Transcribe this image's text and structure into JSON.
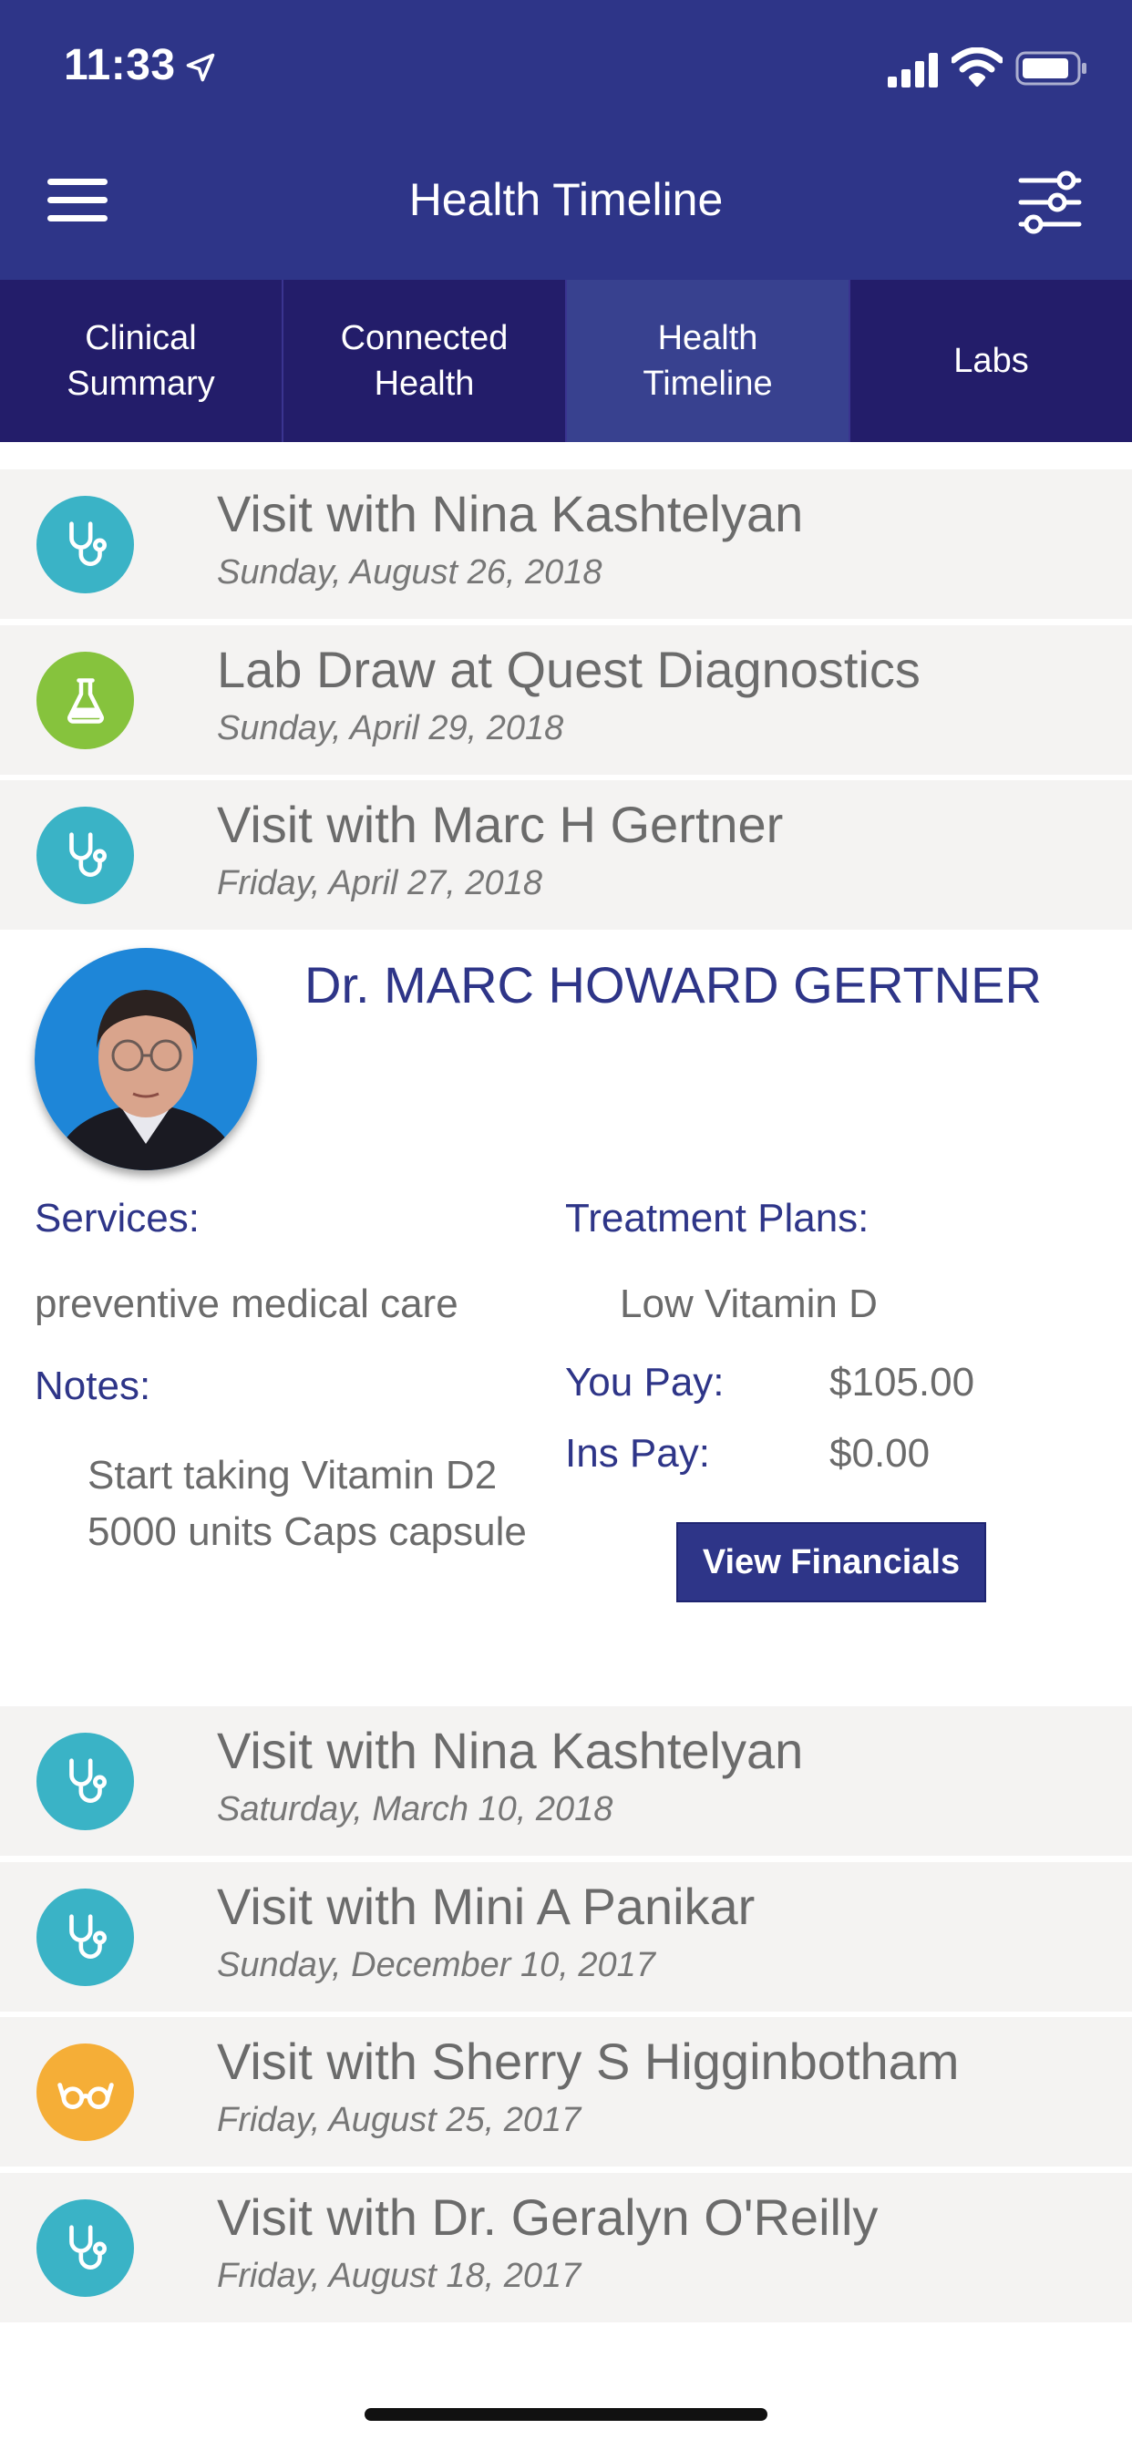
{
  "status_bar": {
    "time": "11:33"
  },
  "nav": {
    "title": "Health Timeline"
  },
  "tabs": [
    {
      "label": "Clinical\nSummary",
      "active": false
    },
    {
      "label": "Connected\nHealth",
      "active": false
    },
    {
      "label": "Health\nTimeline",
      "active": true
    },
    {
      "label": "Labs",
      "active": false
    }
  ],
  "colors": {
    "header": "#2e3588",
    "tabs": "#231d6a",
    "visit_icon": "#3ab3c6",
    "lab_icon": "#86c33d",
    "vision_icon": "#f5ae37"
  },
  "timeline_top": [
    {
      "title": "Visit with Nina Kashtelyan",
      "date": "Sunday, August 26, 2018",
      "icon": "stethoscope-icon"
    },
    {
      "title": "Lab Draw at Quest Diagnostics",
      "date": "Sunday, April 29, 2018",
      "icon": "flask-icon"
    },
    {
      "title": "Visit with Marc H Gertner",
      "date": "Friday, April 27, 2018",
      "icon": "stethoscope-icon"
    }
  ],
  "detail": {
    "doctor_name": "Dr. MARC HOWARD GERTNER",
    "services_label": "Services:",
    "services_value": "preventive medical care",
    "notes_label": "Notes:",
    "notes_value": "Start taking Vitamin D2\n5000 units Caps capsule",
    "treatment_label": "Treatment Plans:",
    "treatment_value": "Low Vitamin D",
    "you_pay_label": "You Pay:",
    "you_pay_value": "$105.00",
    "ins_pay_label": "Ins Pay:",
    "ins_pay_value": "$0.00",
    "financials_button": "View Financials"
  },
  "timeline_bottom": [
    {
      "title": "Visit with Nina Kashtelyan",
      "date": "Saturday, March 10, 2018",
      "icon": "stethoscope-icon"
    },
    {
      "title": "Visit with Mini A Panikar",
      "date": "Sunday, December 10, 2017",
      "icon": "stethoscope-icon"
    },
    {
      "title": "Visit with Sherry S Higginbotham",
      "date": "Friday, August 25, 2017",
      "icon": "glasses-icon"
    },
    {
      "title": "Visit with Dr. Geralyn O'Reilly",
      "date": "Friday, August 18, 2017",
      "icon": "stethoscope-icon"
    }
  ]
}
